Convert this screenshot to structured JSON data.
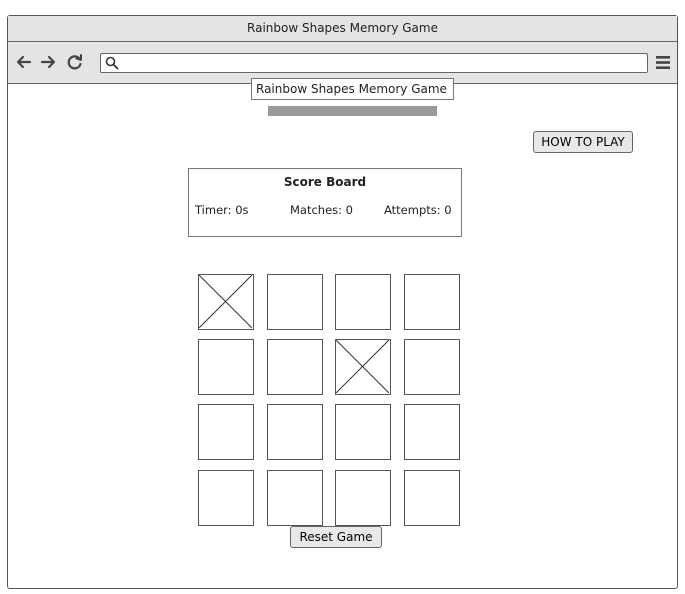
{
  "window": {
    "title": "Rainbow Shapes Memory Game"
  },
  "browser": {
    "address_value": "",
    "icons": [
      "back-arrow-icon",
      "forward-arrow-icon",
      "reload-icon",
      "search-icon",
      "hamburger-menu-icon"
    ]
  },
  "page": {
    "title": "Rainbow Shapes Memory Game",
    "how_to_play_label": "HOW TO PLAY",
    "reset_label": "Reset Game"
  },
  "scoreboard": {
    "title": "Score Board",
    "timer": "Timer: 0s",
    "matches": "Matches: 0",
    "attempts": "Attempts: 0"
  },
  "grid": {
    "rows": 4,
    "cols": 4,
    "cards": [
      {
        "row": 0,
        "col": 0,
        "state": "image-placeholder"
      },
      {
        "row": 0,
        "col": 1,
        "state": "blank"
      },
      {
        "row": 0,
        "col": 2,
        "state": "blank"
      },
      {
        "row": 0,
        "col": 3,
        "state": "blank"
      },
      {
        "row": 1,
        "col": 0,
        "state": "blank"
      },
      {
        "row": 1,
        "col": 1,
        "state": "blank"
      },
      {
        "row": 1,
        "col": 2,
        "state": "image-placeholder"
      },
      {
        "row": 1,
        "col": 3,
        "state": "blank"
      },
      {
        "row": 2,
        "col": 0,
        "state": "blank"
      },
      {
        "row": 2,
        "col": 1,
        "state": "blank"
      },
      {
        "row": 2,
        "col": 2,
        "state": "blank"
      },
      {
        "row": 2,
        "col": 3,
        "state": "blank"
      },
      {
        "row": 3,
        "col": 0,
        "state": "blank"
      },
      {
        "row": 3,
        "col": 1,
        "state": "blank"
      },
      {
        "row": 3,
        "col": 2,
        "state": "blank"
      },
      {
        "row": 3,
        "col": 3,
        "state": "blank"
      }
    ]
  },
  "colors": {
    "chrome_bg": "#e4e4e4",
    "border": "#555555",
    "progress": "#9a9a9a",
    "button_bg": "#e8e8e8"
  }
}
